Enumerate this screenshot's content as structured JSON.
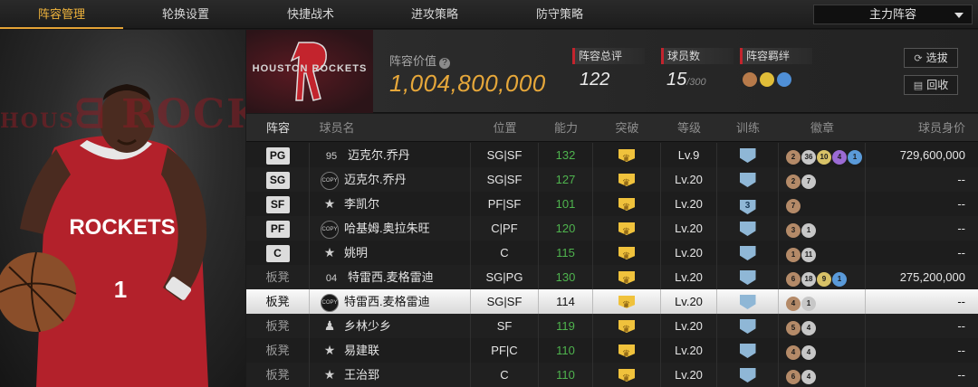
{
  "tabs": [
    {
      "label": "阵容管理",
      "active": true
    },
    {
      "label": "轮换设置",
      "active": false
    },
    {
      "label": "快捷战术",
      "active": false
    },
    {
      "label": "进攻策略",
      "active": false
    },
    {
      "label": "防守策略",
      "active": false
    }
  ],
  "lineup_dropdown": {
    "selected": "主力阵容"
  },
  "team": {
    "name": "HOUSTON ROCKETS"
  },
  "player_art": {
    "jersey_team": "ROCKETS",
    "jersey_number": "1"
  },
  "summary": {
    "value_label": "阵容价值",
    "value": "1,004,800,000",
    "rating_label": "阵容总评",
    "rating": "122",
    "count_label": "球员数",
    "count": "15",
    "count_max": "/300",
    "bond_label": "阵容羁绊"
  },
  "buttons": {
    "select": "选拔",
    "recycle": "回收"
  },
  "table": {
    "headers": [
      "阵容",
      "球员名",
      "位置",
      "能力",
      "突破",
      "等级",
      "训练",
      "徽章",
      "球员身价"
    ],
    "rows": [
      {
        "slot": "PG",
        "slot_type": "starter",
        "card": "95",
        "card_type": "num",
        "name": "迈克尔.乔丹",
        "position": "SG|SF",
        "ability": "132",
        "level": "Lv.9",
        "training": "",
        "badges": [
          {
            "t": "2",
            "c": "bronze"
          },
          {
            "t": "36",
            "c": "silver"
          },
          {
            "t": "10",
            "c": "gold"
          },
          {
            "t": "4",
            "c": "purple"
          },
          {
            "t": "1",
            "c": "blue"
          }
        ],
        "price": "729,600,000"
      },
      {
        "slot": "SG",
        "slot_type": "starter",
        "card": "COPY",
        "card_type": "copy",
        "name": "迈克尔.乔丹",
        "position": "SG|SF",
        "ability": "127",
        "level": "Lv.20",
        "training": "",
        "badges": [
          {
            "t": "2",
            "c": "bronze"
          },
          {
            "t": "7",
            "c": "silver"
          }
        ],
        "price": "--"
      },
      {
        "slot": "SF",
        "slot_type": "starter",
        "card": "★",
        "card_type": "star",
        "name": "李凯尔",
        "position": "PF|SF",
        "ability": "101",
        "level": "Lv.20",
        "training": "3",
        "badges": [
          {
            "t": "7",
            "c": "bronze"
          }
        ],
        "price": "--"
      },
      {
        "slot": "PF",
        "slot_type": "starter",
        "card": "COPY",
        "card_type": "copy",
        "name": "哈基姆.奥拉朱旺",
        "position": "C|PF",
        "ability": "120",
        "level": "Lv.20",
        "training": "",
        "badges": [
          {
            "t": "3",
            "c": "bronze"
          },
          {
            "t": "1",
            "c": "silver"
          }
        ],
        "price": "--"
      },
      {
        "slot": "C",
        "slot_type": "starter",
        "card": "★",
        "card_type": "star",
        "name": "姚明",
        "position": "C",
        "ability": "115",
        "level": "Lv.20",
        "training": "",
        "badges": [
          {
            "t": "1",
            "c": "bronze"
          },
          {
            "t": "11",
            "c": "silver"
          }
        ],
        "price": "--"
      },
      {
        "slot": "板凳",
        "slot_type": "bench",
        "card": "04",
        "card_type": "num",
        "name": "特雷西.麦格雷迪",
        "position": "SG|PG",
        "ability": "130",
        "level": "Lv.20",
        "training": "",
        "badges": [
          {
            "t": "6",
            "c": "bronze"
          },
          {
            "t": "18",
            "c": "silver"
          },
          {
            "t": "9",
            "c": "gold"
          },
          {
            "t": "1",
            "c": "blue"
          }
        ],
        "price": "275,200,000"
      },
      {
        "slot": "板凳",
        "slot_type": "bench",
        "card": "COPY",
        "card_type": "copy",
        "name": "特雷西.麦格雷迪",
        "position": "SG|SF",
        "ability": "114",
        "level": "Lv.20",
        "training": "",
        "badges": [
          {
            "t": "4",
            "c": "bronze"
          },
          {
            "t": "1",
            "c": "silver"
          }
        ],
        "price": "--",
        "selected": true
      },
      {
        "slot": "板凳",
        "slot_type": "bench",
        "card": "♟",
        "card_type": "star",
        "name": "乡林少乡",
        "position": "SF",
        "ability": "119",
        "level": "Lv.20",
        "training": "",
        "badges": [
          {
            "t": "5",
            "c": "bronze"
          },
          {
            "t": "4",
            "c": "silver"
          }
        ],
        "price": "--"
      },
      {
        "slot": "板凳",
        "slot_type": "bench",
        "card": "★",
        "card_type": "star",
        "name": "易建联",
        "position": "PF|C",
        "ability": "110",
        "level": "Lv.20",
        "training": "",
        "badges": [
          {
            "t": "4",
            "c": "bronze"
          },
          {
            "t": "4",
            "c": "silver"
          }
        ],
        "price": "--"
      },
      {
        "slot": "板凳",
        "slot_type": "bench",
        "card": "★",
        "card_type": "star",
        "name": "王治郅",
        "position": "C",
        "ability": "110",
        "level": "Lv.20",
        "training": "",
        "badges": [
          {
            "t": "6",
            "c": "bronze"
          },
          {
            "t": "4",
            "c": "silver"
          }
        ],
        "price": "--"
      }
    ]
  },
  "colors": {
    "accent": "#e3a235",
    "ability_green": "#4fb44e",
    "rockets_red": "#c3242d"
  }
}
